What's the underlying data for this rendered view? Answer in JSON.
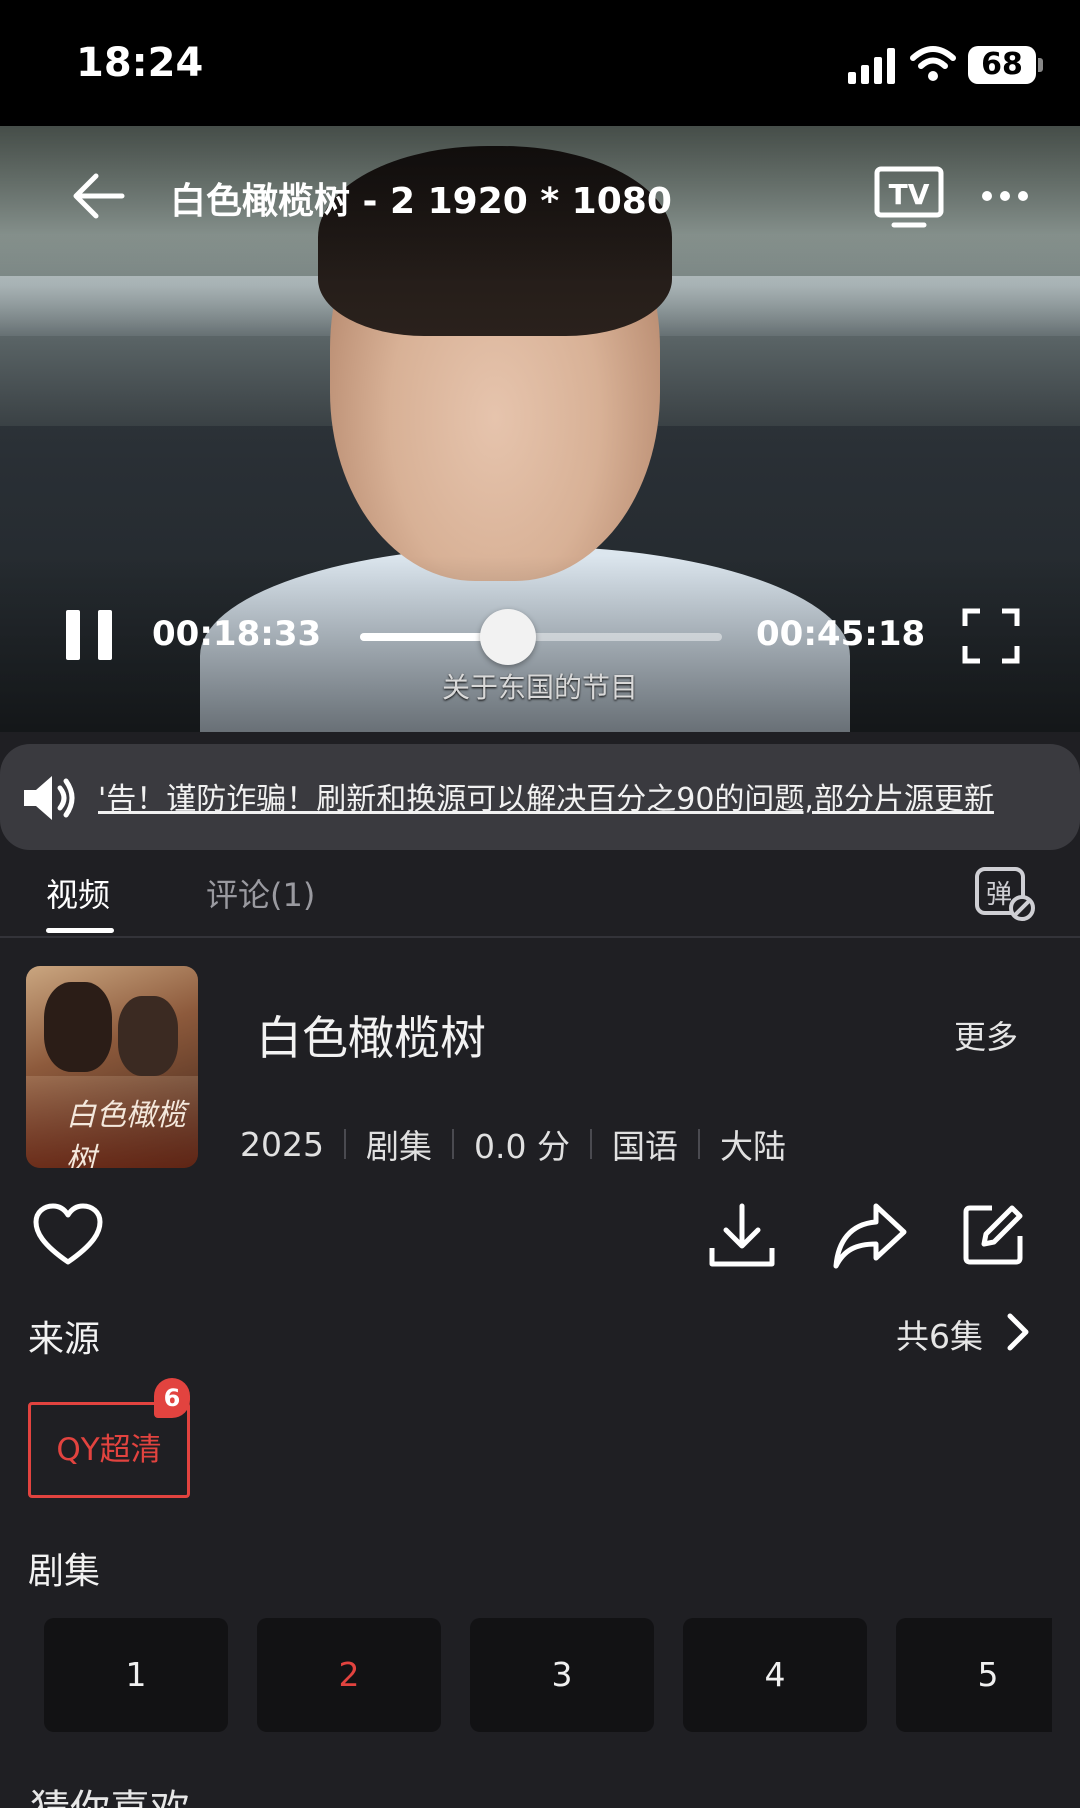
{
  "status_bar": {
    "time": "18:24",
    "battery": "68"
  },
  "player": {
    "title": "白色橄榄树 - 2 1920 * 1080",
    "time_current": "00:18:33",
    "time_total": "00:45:18",
    "progress": 0.41,
    "subtitle": "关于东国的节目"
  },
  "notice": {
    "text": "'告！谨防诈骗！刷新和换源可以解决百分之90的问题,部分片源更新"
  },
  "tabs": {
    "video": "视频",
    "comments": "评论(1)"
  },
  "show": {
    "poster_title": "白色橄榄树",
    "title": "白色橄榄树",
    "more": "更多",
    "meta": [
      "2025",
      "剧集",
      "0.0 分",
      "国语",
      "大陆"
    ]
  },
  "source": {
    "heading": "来源",
    "episode_count": "共6集",
    "chip_label": "QY超清",
    "chip_badge": "6"
  },
  "episodes": {
    "heading": "剧集",
    "items": [
      "1",
      "2",
      "3",
      "4",
      "5"
    ],
    "active_index": 1
  },
  "recommend": {
    "heading_peek": "猜你喜欢"
  },
  "colors": {
    "accent": "#e2433f",
    "background": "#1f1f23",
    "notice_bg": "#3a3a3f"
  }
}
